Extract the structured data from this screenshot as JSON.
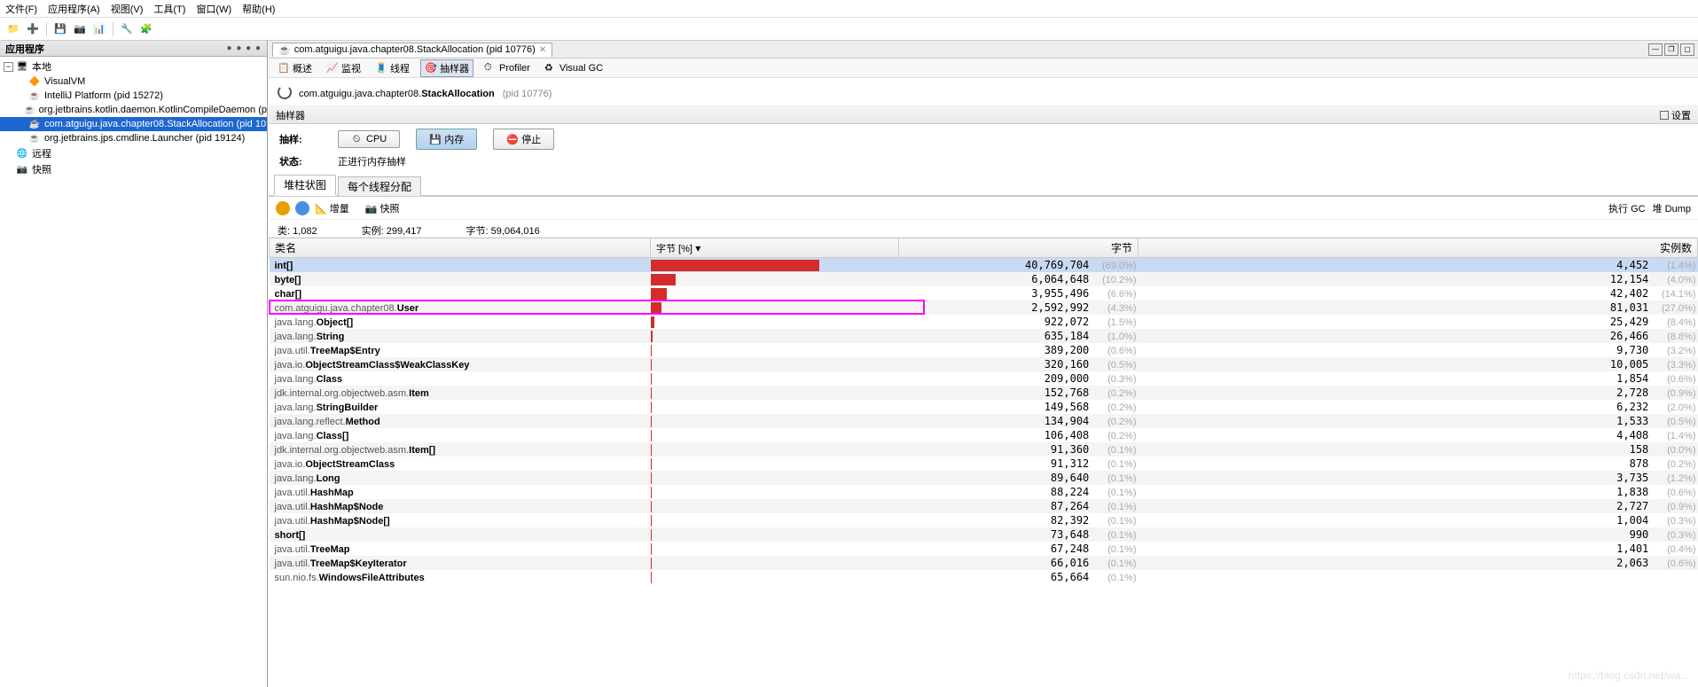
{
  "menu": {
    "file": "文件(F)",
    "apps": "应用程序(A)",
    "view": "视图(V)",
    "tools": "工具(T)",
    "window": "窗口(W)",
    "help": "帮助(H)"
  },
  "sidebar": {
    "title": "应用程序",
    "nodes": {
      "local": "本地",
      "visualvm": "VisualVM",
      "intellij": "IntelliJ Platform (pid 15272)",
      "kotlin": "org.jetbrains.kotlin.daemon.KotlinCompileDaemon (p",
      "stack": "com.atguigu.java.chapter08.StackAllocation (pid 10",
      "launcher": "org.jetbrains.jps.cmdline.Launcher (pid 19124)",
      "remote": "远程",
      "snapshot": "快照"
    }
  },
  "docTab": {
    "title": "com.atguigu.java.chapter08.StackAllocation (pid 10776)"
  },
  "viewTabs": {
    "overview": "概述",
    "monitor": "监视",
    "threads": "线程",
    "sampler": "抽样器",
    "profiler": "Profiler",
    "visualgc": "Visual GC"
  },
  "titleRow": {
    "pkg": "com.atguigu.java.chapter08.",
    "cls": "StackAllocation",
    "pid": "(pid 10776)"
  },
  "sectionBar": {
    "label": "抽样器",
    "settings": "设置"
  },
  "sampleControls": {
    "sampleLabel": "抽样:",
    "cpu": "CPU",
    "mem": "内存",
    "stop": "停止",
    "statusLabel": "状态:",
    "statusText": "正进行内存抽样"
  },
  "innerTabs": {
    "heap": "堆柱状图",
    "perthread": "每个线程分配"
  },
  "actionRow": {
    "delta": "增量",
    "snapshot": "快照",
    "gc": "执行 GC",
    "dump": "堆 Dump"
  },
  "summary": {
    "classesLabel": "类:",
    "classes": "1,082",
    "instLabel": "实例:",
    "instances": "299,417",
    "bytesLabel": "字节:",
    "bytes": "59,064,016"
  },
  "columns": {
    "name": "类名",
    "bytesPct": "字节 [%]",
    "bytes": "字节",
    "instances": "实例数"
  },
  "rows": [
    {
      "pkg": "",
      "cls": "int[]",
      "barPct": 68.0,
      "bytes": "40,769,704",
      "bytesPct": "(69.0%)",
      "inst": "4,452",
      "instPct": "(1.4%)",
      "sel": true
    },
    {
      "pkg": "",
      "cls": "byte[]",
      "barPct": 10.2,
      "bytes": "6,064,648",
      "bytesPct": "(10.2%)",
      "inst": "12,154",
      "instPct": "(4.0%)"
    },
    {
      "pkg": "",
      "cls": "char[]",
      "barPct": 6.6,
      "bytes": "3,955,496",
      "bytesPct": "(6.6%)",
      "inst": "42,402",
      "instPct": "(14.1%)"
    },
    {
      "pkg": "com.atguigu.java.chapter08.",
      "cls": "User",
      "barPct": 4.3,
      "bytes": "2,592,992",
      "bytesPct": "(4.3%)",
      "inst": "81,031",
      "instPct": "(27.0%)",
      "hl": true
    },
    {
      "pkg": "java.lang.",
      "cls": "Object[]",
      "barPct": 1.5,
      "bytes": "922,072",
      "bytesPct": "(1.5%)",
      "inst": "25,429",
      "instPct": "(8.4%)"
    },
    {
      "pkg": "java.lang.",
      "cls": "String",
      "barPct": 1.0,
      "bytes": "635,184",
      "bytesPct": "(1.0%)",
      "inst": "26,466",
      "instPct": "(8.8%)"
    },
    {
      "pkg": "java.util.",
      "cls": "TreeMap$Entry",
      "barPct": 0.6,
      "bytes": "389,200",
      "bytesPct": "(0.6%)",
      "inst": "9,730",
      "instPct": "(3.2%)"
    },
    {
      "pkg": "java.io.",
      "cls": "ObjectStreamClass$WeakClassKey",
      "barPct": 0.5,
      "bytes": "320,160",
      "bytesPct": "(0.5%)",
      "inst": "10,005",
      "instPct": "(3.3%)"
    },
    {
      "pkg": "java.lang.",
      "cls": "Class",
      "barPct": 0.3,
      "bytes": "209,000",
      "bytesPct": "(0.3%)",
      "inst": "1,854",
      "instPct": "(0.6%)"
    },
    {
      "pkg": "jdk.internal.org.objectweb.asm.",
      "cls": "Item",
      "barPct": 0.2,
      "bytes": "152,768",
      "bytesPct": "(0.2%)",
      "inst": "2,728",
      "instPct": "(0.9%)"
    },
    {
      "pkg": "java.lang.",
      "cls": "StringBuilder",
      "barPct": 0.2,
      "bytes": "149,568",
      "bytesPct": "(0.2%)",
      "inst": "6,232",
      "instPct": "(2.0%)"
    },
    {
      "pkg": "java.lang.reflect.",
      "cls": "Method",
      "barPct": 0.2,
      "bytes": "134,904",
      "bytesPct": "(0.2%)",
      "inst": "1,533",
      "instPct": "(0.5%)"
    },
    {
      "pkg": "java.lang.",
      "cls": "Class[]",
      "barPct": 0.2,
      "bytes": "106,408",
      "bytesPct": "(0.2%)",
      "inst": "4,408",
      "instPct": "(1.4%)"
    },
    {
      "pkg": "jdk.internal.org.objectweb.asm.",
      "cls": "Item[]",
      "barPct": 0.1,
      "bytes": "91,360",
      "bytesPct": "(0.1%)",
      "inst": "158",
      "instPct": "(0.0%)"
    },
    {
      "pkg": "java.io.",
      "cls": "ObjectStreamClass",
      "barPct": 0.1,
      "bytes": "91,312",
      "bytesPct": "(0.1%)",
      "inst": "878",
      "instPct": "(0.2%)"
    },
    {
      "pkg": "java.lang.",
      "cls": "Long",
      "barPct": 0.1,
      "bytes": "89,640",
      "bytesPct": "(0.1%)",
      "inst": "3,735",
      "instPct": "(1.2%)"
    },
    {
      "pkg": "java.util.",
      "cls": "HashMap",
      "barPct": 0.1,
      "bytes": "88,224",
      "bytesPct": "(0.1%)",
      "inst": "1,838",
      "instPct": "(0.6%)"
    },
    {
      "pkg": "java.util.",
      "cls": "HashMap$Node",
      "barPct": 0.1,
      "bytes": "87,264",
      "bytesPct": "(0.1%)",
      "inst": "2,727",
      "instPct": "(0.9%)"
    },
    {
      "pkg": "java.util.",
      "cls": "HashMap$Node[]",
      "barPct": 0.1,
      "bytes": "82,392",
      "bytesPct": "(0.1%)",
      "inst": "1,004",
      "instPct": "(0.3%)"
    },
    {
      "pkg": "",
      "cls": "short[]",
      "barPct": 0.1,
      "bytes": "73,648",
      "bytesPct": "(0.1%)",
      "inst": "990",
      "instPct": "(0.3%)"
    },
    {
      "pkg": "java.util.",
      "cls": "TreeMap",
      "barPct": 0.1,
      "bytes": "67,248",
      "bytesPct": "(0.1%)",
      "inst": "1,401",
      "instPct": "(0.4%)"
    },
    {
      "pkg": "java.util.",
      "cls": "TreeMap$KeyIterator",
      "barPct": 0.1,
      "bytes": "66,016",
      "bytesPct": "(0.1%)",
      "inst": "2,063",
      "instPct": "(0.6%)"
    },
    {
      "pkg": "sun.nio.fs.",
      "cls": "WindowsFileAttributes",
      "barPct": 0.1,
      "bytes": "65,664",
      "bytesPct": "(0.1%)",
      "inst": "",
      "instPct": ""
    }
  ],
  "watermark": "https://blog.csdn.net/wa..."
}
